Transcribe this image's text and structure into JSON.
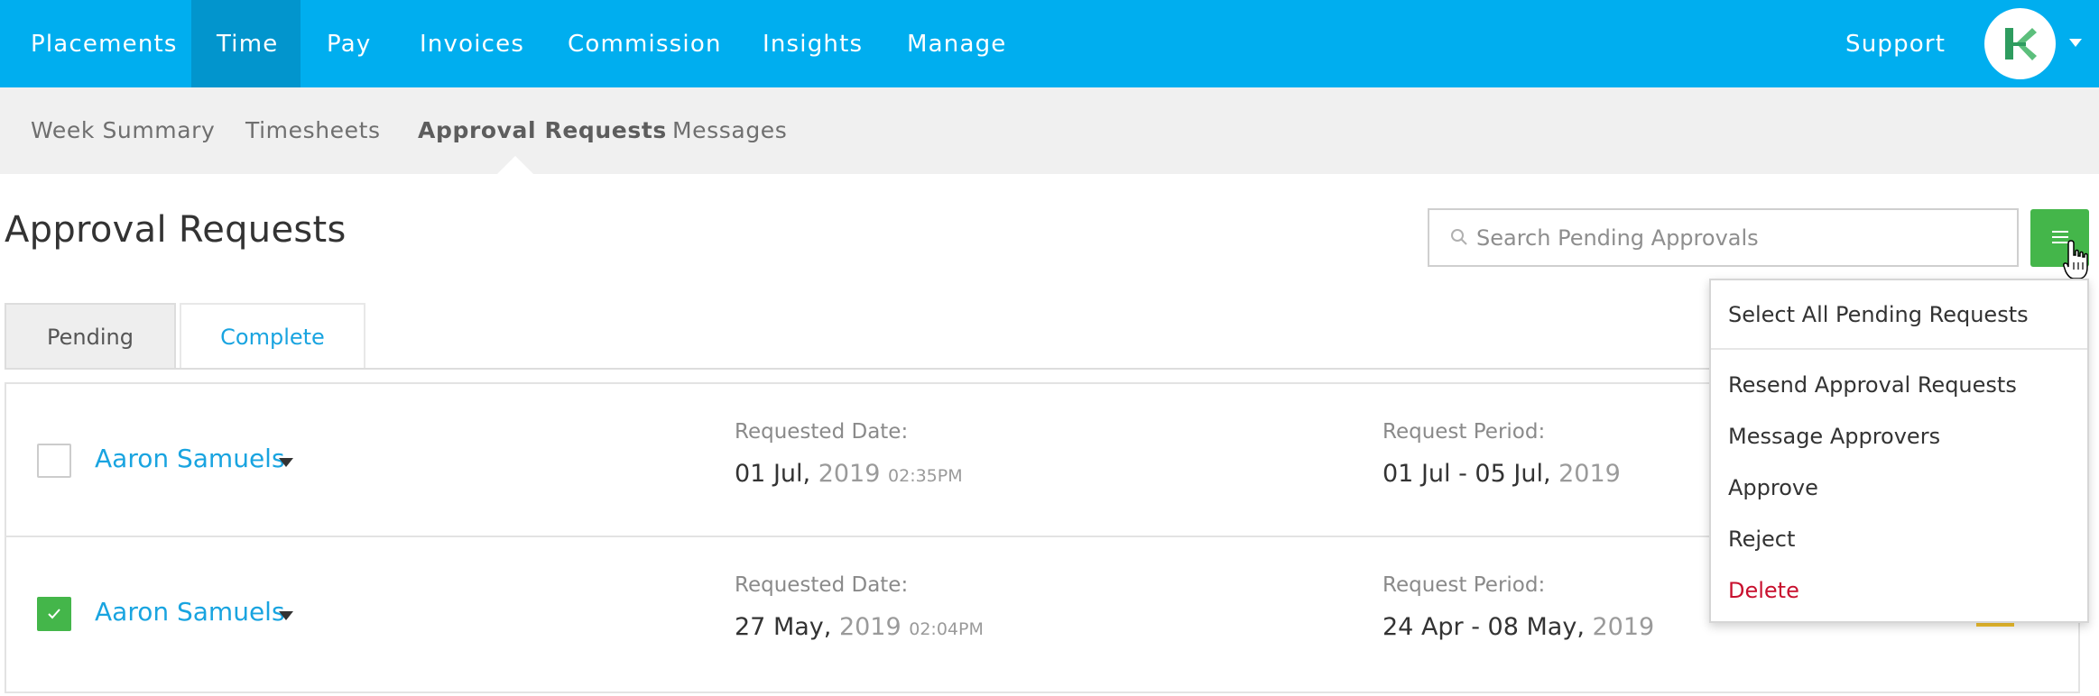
{
  "topnav": {
    "items": [
      "Placements",
      "Time",
      "Pay",
      "Invoices",
      "Commission",
      "Insights",
      "Manage"
    ],
    "active": "Time",
    "support_label": "Support",
    "background": "#00aeef",
    "active_background": "#0295cd",
    "avatar_icon": "k-logo-icon"
  },
  "subnav": {
    "items": [
      "Week Summary",
      "Timesheets",
      "Approval Requests",
      "Messages"
    ],
    "active": "Approval Requests"
  },
  "page": {
    "title": "Approval Requests",
    "search_placeholder": "Search Pending Approvals",
    "menu_icon": "hamburger-icon"
  },
  "tabs": {
    "pending": "Pending",
    "complete": "Complete"
  },
  "requests": [
    {
      "name": "Aaron Samuels",
      "checked": false,
      "requested_label": "Requested Date:",
      "requested_day_month": "01 Jul,",
      "requested_year": "2019",
      "requested_time": "02:35PM",
      "period_label": "Request Period:",
      "period_range": "01 Jul - 05 Jul,",
      "period_year": "2019"
    },
    {
      "name": "Aaron Samuels",
      "checked": true,
      "requested_label": "Requested Date:",
      "requested_day_month": "27 May,",
      "requested_year": "2019",
      "requested_time": "02:04PM",
      "period_label": "Request Period:",
      "period_range": "24 Apr - 08 May,",
      "period_year": "2019"
    }
  ],
  "menu": {
    "select_all": "Select All Pending Requests",
    "resend": "Resend Approval Requests",
    "message": "Message Approvers",
    "approve": "Approve",
    "reject": "Reject",
    "delete": "Delete"
  },
  "colors": {
    "accent_green": "#44b64a",
    "link_blue": "#19a4e0",
    "danger_red": "#c8102e"
  }
}
